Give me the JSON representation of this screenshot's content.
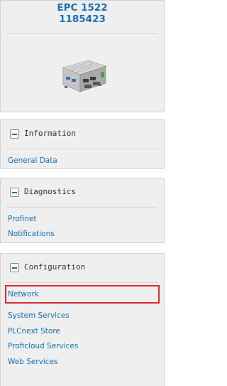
{
  "device": {
    "model": "EPC 1522",
    "number": "1185423",
    "image": "device-image"
  },
  "panels": [
    {
      "title": "Information",
      "toggle_icon": "collapse-icon",
      "links": [
        "General Data"
      ]
    },
    {
      "title": "Diagnostics",
      "toggle_icon": "collapse-icon",
      "links": [
        "Profinet",
        "Notifications"
      ]
    },
    {
      "title": "Configuration",
      "toggle_icon": "collapse-icon",
      "links": [
        "Network",
        "System Services",
        "PLCnext Store",
        "Proficloud Services",
        "Web Services"
      ],
      "selected_link": "Network"
    }
  ],
  "colors": {
    "link": "#1a6fb0",
    "selection_border": "#d9282f",
    "panel_bg": "#efefef"
  }
}
